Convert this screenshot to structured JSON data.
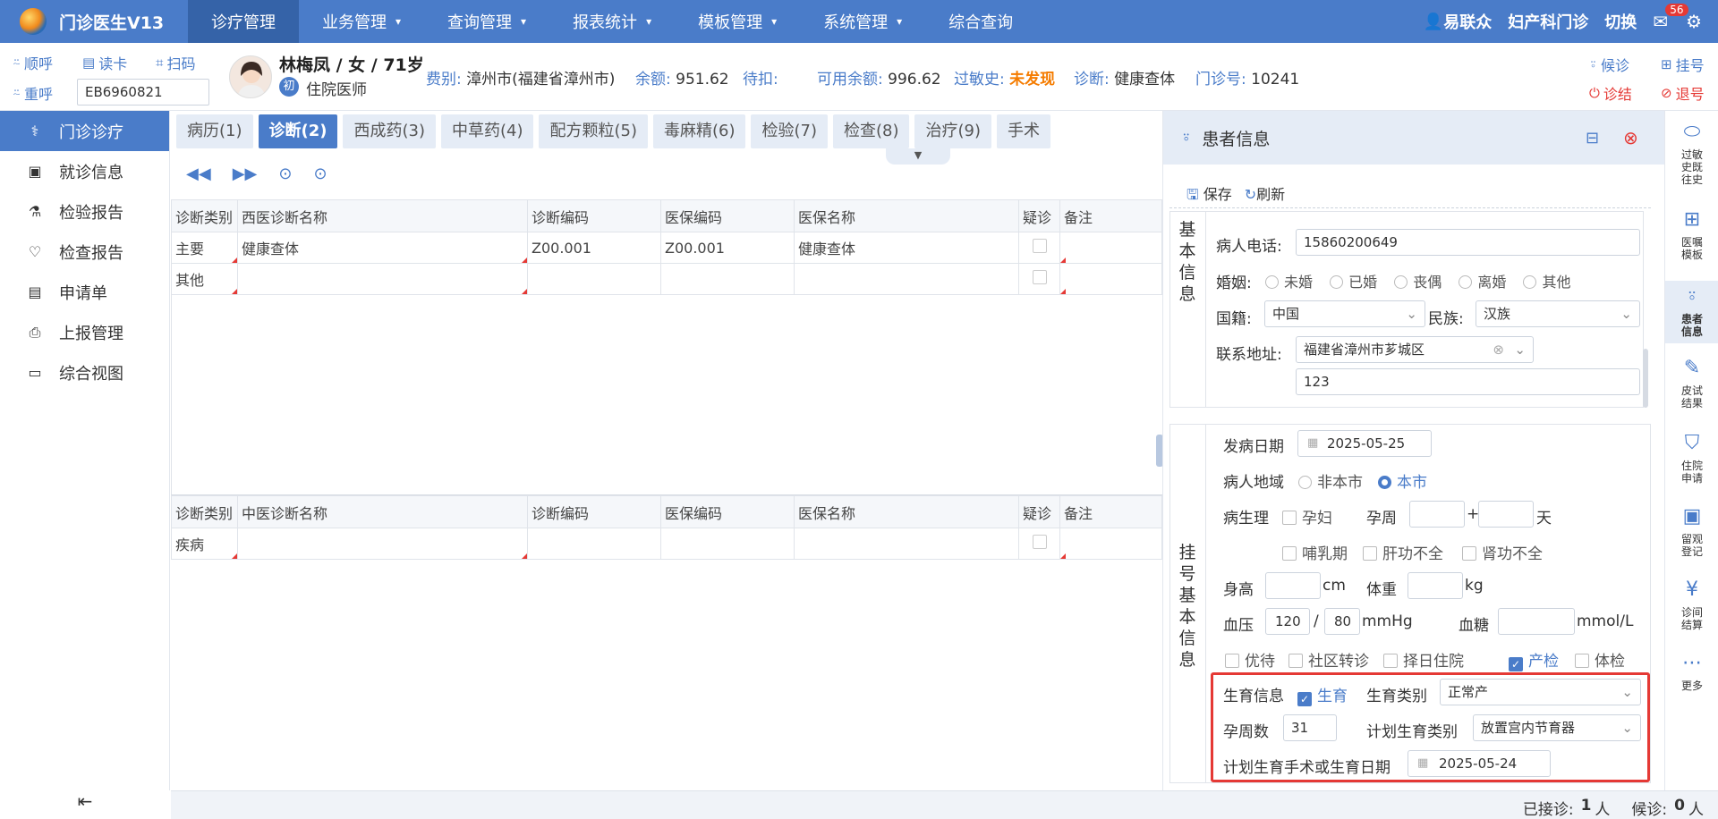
{
  "app": {
    "title": "门诊医生V13"
  },
  "nav": {
    "items": [
      {
        "label": "诊疗管理"
      },
      {
        "label": "业务管理"
      },
      {
        "label": "查询管理"
      },
      {
        "label": "报表统计"
      },
      {
        "label": "模板管理"
      },
      {
        "label": "系统管理"
      },
      {
        "label": "综合查询"
      }
    ],
    "chev": "⌄"
  },
  "top_right": {
    "user": "易联众",
    "dept": "妇产科门诊",
    "switch": "切换",
    "mail_count": "56"
  },
  "patient_bar": {
    "shunhu": "顺呼",
    "duka": "读卡",
    "saoma": "扫码",
    "chonghu": "重呼",
    "card_no": "EB6960821",
    "name": "林梅凤 / 女 / 71岁",
    "chu": "初",
    "status": "住院医师",
    "feibie_k": "费别:",
    "feibie_v": "漳州市(福建省漳州市)",
    "yue_k": "余额:",
    "yue_v": "951.62",
    "daikou_k": "待扣:",
    "keyong_k": "可用余额:",
    "keyong_v": "996.62",
    "guomin_k": "过敏史:",
    "guomin_v": "未发现",
    "zhenduan_k": "诊断:",
    "zhenduan_v": "健康查体",
    "menzhen_k": "门诊号:",
    "menzhen_v": "10241",
    "houzhen": "候诊",
    "guahao": "挂号",
    "zhenjie": "诊结",
    "tuihao": "退号"
  },
  "sidebar": {
    "items": [
      {
        "label": "门诊诊疗"
      },
      {
        "label": "就诊信息"
      },
      {
        "label": "检验报告"
      },
      {
        "label": "检查报告"
      },
      {
        "label": "申请单"
      },
      {
        "label": "上报管理"
      },
      {
        "label": "综合视图"
      }
    ]
  },
  "tabs": [
    {
      "label": "病历(1)"
    },
    {
      "label": "诊断(2)"
    },
    {
      "label": "西成药(3)"
    },
    {
      "label": "中草药(4)"
    },
    {
      "label": "配方颗粒(5)"
    },
    {
      "label": "毒麻精(6)"
    },
    {
      "label": "检验(7)"
    },
    {
      "label": "检查(8)"
    },
    {
      "label": "治疗(9)"
    },
    {
      "label": "手术"
    }
  ],
  "western_table": {
    "headers": [
      "诊断类别",
      "西医诊断名称",
      "诊断编码",
      "医保编码",
      "医保名称",
      "疑诊",
      "备注"
    ],
    "rows": [
      [
        "主要",
        "健康查体",
        "Z00.001",
        "Z00.001",
        "健康查体",
        "",
        ""
      ],
      [
        "其他",
        "",
        "",
        "",
        "",
        "",
        ""
      ]
    ]
  },
  "chinese_table": {
    "headers": [
      "诊断类别",
      "中医诊断名称",
      "诊断编码",
      "医保编码",
      "医保名称",
      "疑诊",
      "备注"
    ],
    "rows": [
      [
        "疾病",
        "",
        "",
        "",
        "",
        "",
        ""
      ]
    ]
  },
  "patient_panel": {
    "title": "患者信息",
    "save": "保存",
    "refresh": "刷新",
    "sec1": [
      "基",
      "本",
      "信",
      "息"
    ],
    "phone_k": "病人电话:",
    "phone_v": "15860200649",
    "marital_k": "婚姻:",
    "marital_opts": [
      "未婚",
      "已婚",
      "丧偶",
      "离婚",
      "其他"
    ],
    "nation_k": "国籍:",
    "nation_v": "中国",
    "ethnic_k": "民族:",
    "ethnic_v": "汉族",
    "addr_k": "联系地址:",
    "addr_v": "福建省漳州市芗城区",
    "addr2_v": "123",
    "sec2": [
      "挂",
      "号",
      "基",
      "本",
      "信",
      "息"
    ],
    "onset_k": "发病日期",
    "onset_v": "2025-05-25",
    "region_k": "病人地域",
    "region_opt1": "非本市",
    "region_opt2": "本市",
    "phys_k": "病生理",
    "pregnant": "孕妇",
    "week_k": "孕周",
    "plus": "+",
    "day": "天",
    "lactation": "哺乳期",
    "liver": "肝功不全",
    "kidney": "肾功不全",
    "height_k": "身高",
    "height_u": "cm",
    "weight_k": "体重",
    "weight_u": "kg",
    "bp_k": "血压",
    "bp_sys": "120",
    "bp_sep": "/",
    "bp_dia": "80",
    "bp_u": "mmHg",
    "glu_k": "血糖",
    "glu_u": "mmol/L",
    "youdai": "优待",
    "shequ": "社区转诊",
    "zeri": "择日住院",
    "chanjian": "产检",
    "tijian": "体检",
    "birth_k": "生育信息",
    "birth_cb": "生育",
    "birth_type_k": "生育类别",
    "birth_type_v": "正常产",
    "gest_k": "孕周数",
    "gest_v": "31",
    "plan_k": "计划生育类别",
    "plan_v": "放置宫内节育器",
    "plan_date_k": "计划生育手术或生育日期",
    "plan_date_v": "2025-05-24"
  },
  "right_bar": [
    {
      "label": "过敏史既往史"
    },
    {
      "label": "医嘱模板"
    },
    {
      "label": "患者信息"
    },
    {
      "label": "皮试结果"
    },
    {
      "label": "住院申请"
    },
    {
      "label": "留观登记"
    },
    {
      "label": "诊间结算"
    },
    {
      "label": "更多"
    }
  ],
  "status": {
    "received_k": "已接诊:",
    "received_v": "1",
    "waiting_k": "候诊:",
    "waiting_v": "0",
    "unit": "人"
  }
}
